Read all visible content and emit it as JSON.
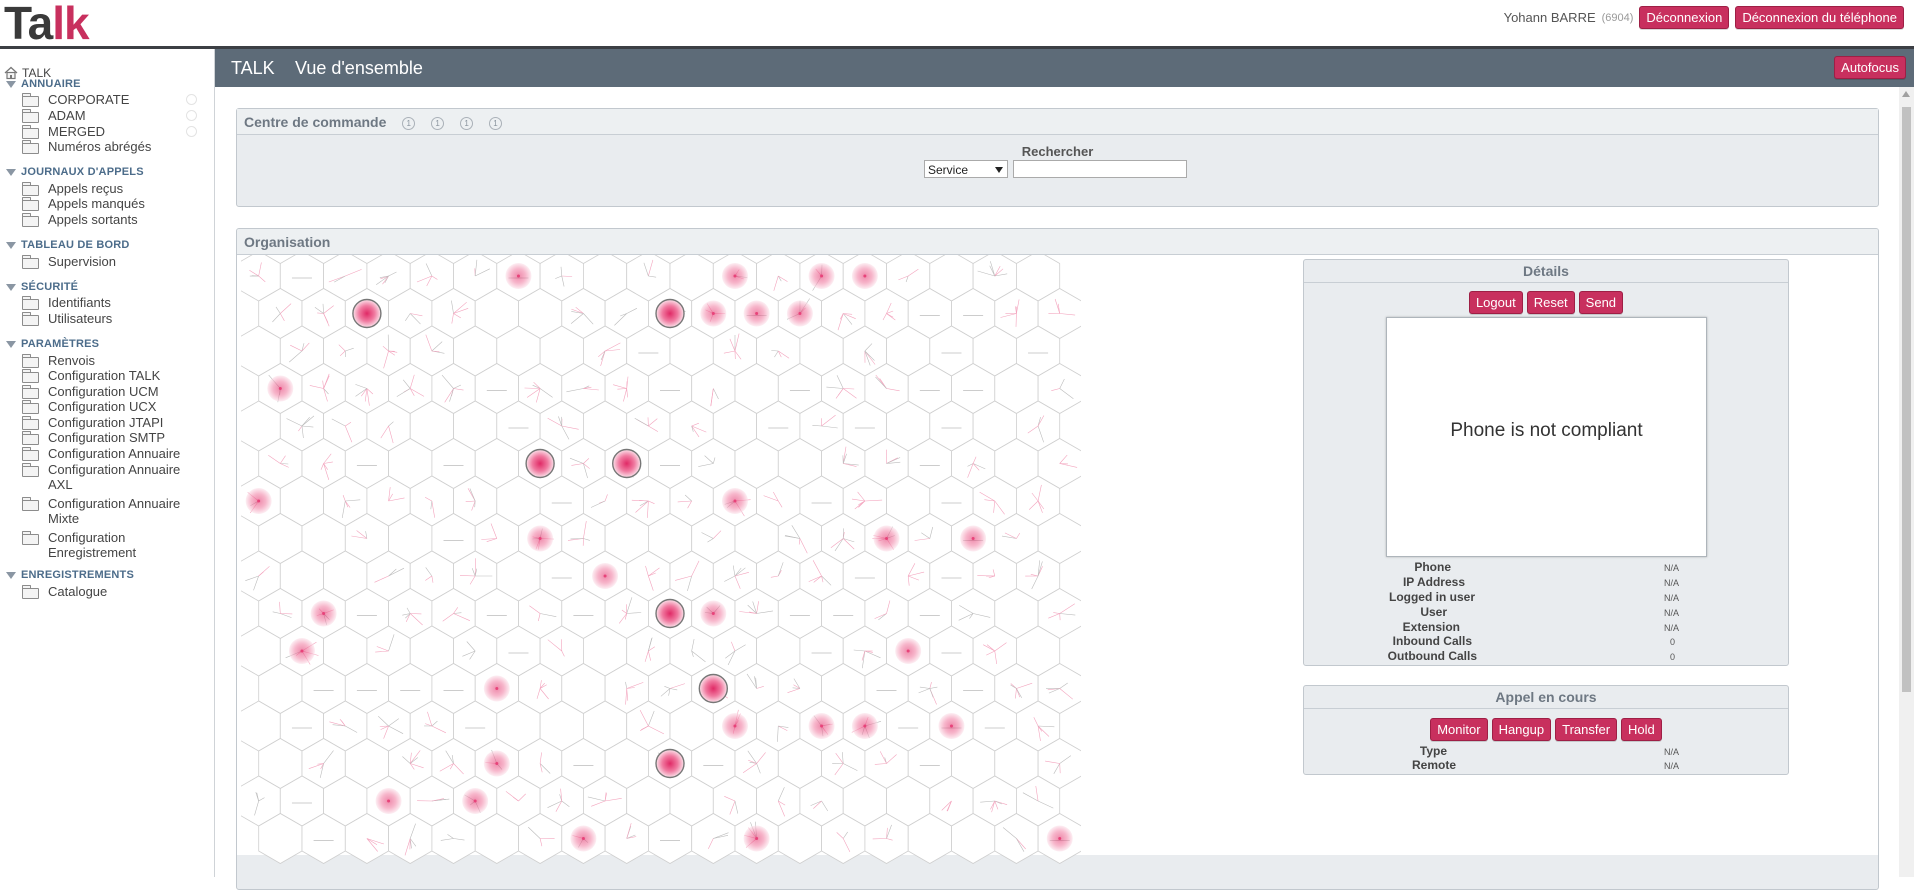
{
  "brand": {
    "logo_part1": "Ta",
    "logo_part2": "lk"
  },
  "user": {
    "name": "Yohann BARRE",
    "ext": "(6904)",
    "logout": "Déconnexion",
    "phone_logout": "Déconnexion du téléphone"
  },
  "sidebar": {
    "home": "TALK",
    "sections": [
      {
        "title": "ANNUAIRE",
        "items": [
          "CORPORATE",
          "ADAM",
          "MERGED",
          "Numéros abrégés"
        ]
      },
      {
        "title": "JOURNAUX D'APPELS",
        "items": [
          "Appels reçus",
          "Appels manqués",
          "Appels sortants"
        ]
      },
      {
        "title": "TABLEAU DE BORD",
        "items": [
          "Supervision"
        ]
      },
      {
        "title": "SÉCURITÉ",
        "items": [
          "Identifiants",
          "Utilisateurs"
        ]
      },
      {
        "title": "PARAMÈTRES",
        "items": [
          "Renvois",
          "Configuration TALK",
          "Configuration UCM",
          "Configuration UCX",
          "Configuration JTAPI",
          "Configuration SMTP",
          "Configuration Annuaire",
          "Configuration Annuaire AXL",
          "Configuration Annuaire Mixte",
          "Configuration Enregistrement"
        ]
      },
      {
        "title": "ENREGISTREMENTS",
        "items": [
          "Catalogue"
        ]
      }
    ]
  },
  "header": {
    "app": "TALK",
    "page": "Vue d'ensemble",
    "autofocus": "Autofocus"
  },
  "command_center": {
    "title": "Centre de commande",
    "search_label": "Rechercher",
    "search_type": "Service",
    "search_value": ""
  },
  "organisation": {
    "title": "Organisation"
  },
  "details": {
    "title": "Détails",
    "buttons": [
      "Logout",
      "Reset",
      "Send"
    ],
    "screen_message": "Phone is not compliant",
    "fields": [
      {
        "label": "Phone",
        "value": "N/A"
      },
      {
        "label": "IP Address",
        "value": "N/A"
      },
      {
        "label": "Logged in user",
        "value": "N/A"
      },
      {
        "label": "User",
        "value": "N/A"
      },
      {
        "label": "Extension",
        "value": "N/A"
      },
      {
        "label": "Inbound Calls",
        "value": "0"
      },
      {
        "label": "Outbound Calls",
        "value": "0"
      }
    ]
  },
  "call": {
    "title": "Appel en cours",
    "buttons": [
      "Monitor",
      "Hangup",
      "Transfer",
      "Hold"
    ],
    "fields": [
      {
        "label": "Type",
        "value": "N/A"
      },
      {
        "label": "Remote",
        "value": "N/A"
      }
    ]
  },
  "colors": {
    "accent": "#c8305e",
    "header_bg": "#5d6b78",
    "panel_bg": "#e9ecef",
    "hex_stroke": "#cfcfcf",
    "node_pink": "#e8437a"
  }
}
